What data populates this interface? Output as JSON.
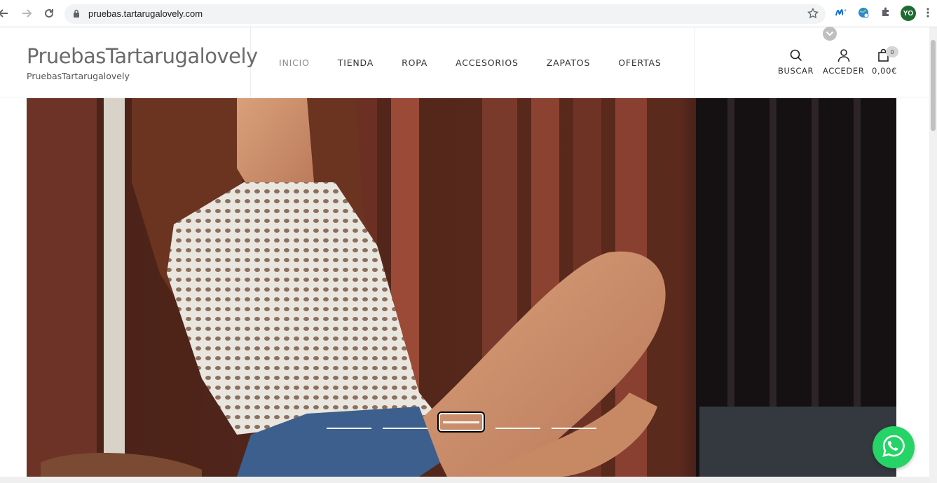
{
  "browser": {
    "url": "pruebas.tartarugalovely.com",
    "profile_initials": "YO",
    "icons": [
      "back-icon",
      "forward-icon",
      "reload-icon",
      "lock-icon",
      "bookmark-star-icon",
      "movistar-extension-icon",
      "globe-extension-icon",
      "puzzle-extensions-icon",
      "profile-avatar",
      "menu-kebab-icon"
    ]
  },
  "site": {
    "title": "PruebasTartarugalovely",
    "tagline": "PruebasTartarugalovely"
  },
  "menu": {
    "items": [
      {
        "label": "INICIO",
        "active": true
      },
      {
        "label": "TIENDA",
        "active": false
      },
      {
        "label": "ROPA",
        "active": false
      },
      {
        "label": "ACCESORIOS",
        "active": false
      },
      {
        "label": "ZAPATOS",
        "active": false
      },
      {
        "label": "OFERTAS",
        "active": false
      }
    ]
  },
  "header_tools": {
    "search_label": "BUSCAR",
    "account_label": "ACCEDER",
    "cart_total": "0,00€",
    "cart_count": "0"
  },
  "slider": {
    "slides": 5,
    "active_index": 2
  },
  "colors": {
    "whatsapp": "#25d366",
    "menu_active": "#8a8a8a",
    "profile": "#1e6b32"
  }
}
